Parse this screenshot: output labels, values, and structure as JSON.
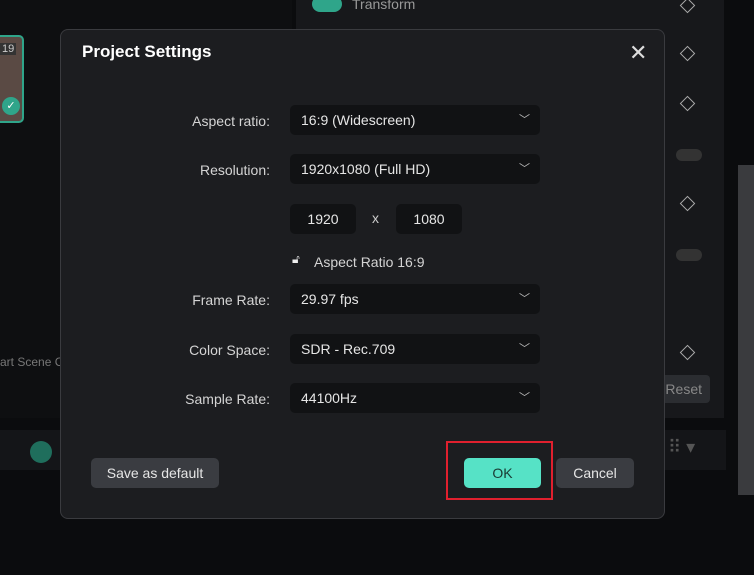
{
  "background": {
    "transform_label": "Transform",
    "thumb_badge": "19",
    "scene_text": "art Scene C",
    "reset_label": "Reset"
  },
  "dialog": {
    "title": "Project Settings",
    "fields": [
      {
        "label": "Aspect ratio:",
        "value": "16:9 (Widescreen)"
      },
      {
        "label": "Resolution:",
        "value": "1920x1080 (Full HD)"
      },
      {
        "label": "Frame Rate:",
        "value": "29.97 fps"
      },
      {
        "label": "Color Space:",
        "value": "SDR - Rec.709"
      },
      {
        "label": "Sample Rate:",
        "value": "44100Hz"
      }
    ],
    "width": "1920",
    "x": "x",
    "height": "1080",
    "aspect_lock_label": "Aspect Ratio 16:9",
    "save_default": "Save as default",
    "ok": "OK",
    "cancel": "Cancel"
  }
}
